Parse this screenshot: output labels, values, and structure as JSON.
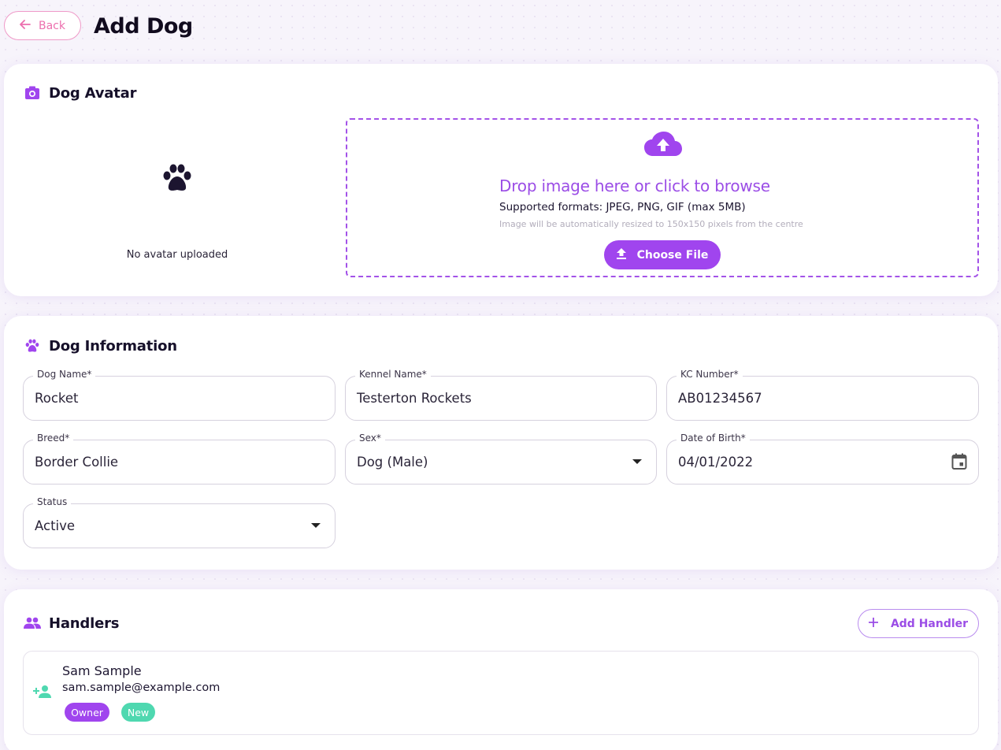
{
  "header": {
    "back_label": "Back",
    "title": "Add Dog"
  },
  "avatar_section": {
    "title": "Dog Avatar",
    "no_avatar_text": "No avatar uploaded",
    "dropzone": {
      "title": "Drop image here or click to browse",
      "formats": "Supported formats: JPEG, PNG, GIF (max 5MB)",
      "note": "Image will be automatically resized to 150x150 pixels from the centre",
      "button_label": "Choose File"
    }
  },
  "info_section": {
    "title": "Dog Information",
    "fields": {
      "dog_name": {
        "label": "Dog Name*",
        "value": "Rocket"
      },
      "kennel_name": {
        "label": "Kennel Name*",
        "value": "Testerton Rockets"
      },
      "kc_number": {
        "label": "KC Number*",
        "value": "AB01234567"
      },
      "breed": {
        "label": "Breed*",
        "value": "Border Collie"
      },
      "sex": {
        "label": "Sex*",
        "value": "Dog (Male)"
      },
      "dob": {
        "label": "Date of Birth*",
        "value": "04/01/2022"
      },
      "status": {
        "label": "Status",
        "value": "Active"
      }
    }
  },
  "handlers_section": {
    "title": "Handlers",
    "add_label": "Add Handler",
    "handlers": [
      {
        "name": "Sam Sample",
        "email": "sam.sample@example.com",
        "badges": [
          "Owner",
          "New"
        ]
      }
    ]
  },
  "colors": {
    "accent": "#a045ee",
    "back_pink": "#ec6fae",
    "new_badge": "#4fd8b0"
  },
  "icons": [
    "arrow-left-icon",
    "camera-icon",
    "paw-icon",
    "cloud-upload-icon",
    "upload-icon",
    "caret-down-icon",
    "calendar-icon",
    "group-icon",
    "plus-icon",
    "person-add-icon"
  ]
}
